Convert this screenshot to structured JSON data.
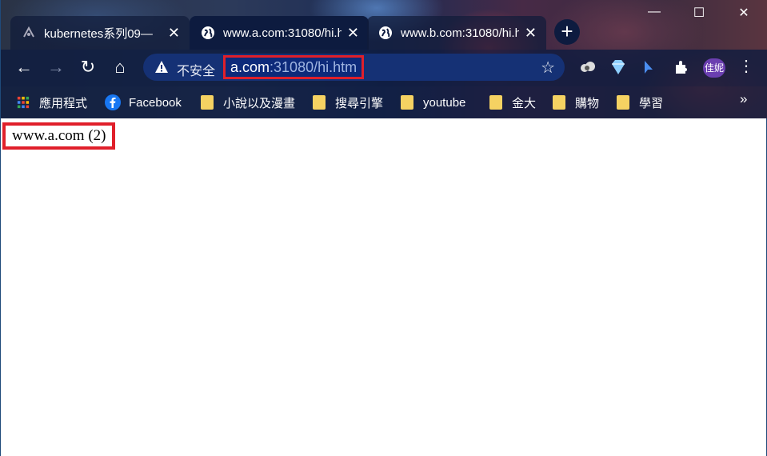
{
  "tabs": [
    {
      "title": "kubernetes系列09—",
      "close": "✕",
      "icon": "k8s-logo-icon"
    },
    {
      "title": "www.a.com:31080/hi.h",
      "close": "✕",
      "icon": "globe-icon"
    },
    {
      "title": "www.b.com:31080/hi.h",
      "close": "✕",
      "icon": "globe-icon"
    }
  ],
  "new_tab": "+",
  "window_controls": {
    "minimize": "—",
    "maximize": "☐",
    "close": "✕"
  },
  "toolbar": {
    "back": "←",
    "forward": "→",
    "reload": "↻",
    "home": "⌂",
    "security_label": "不安全",
    "url_host": "a.com",
    "url_path": ":31080/hi.htm",
    "bookmark_star": "☆",
    "profile_label": "佳妮",
    "menu": "⋮"
  },
  "bookmarks": [
    {
      "label": "應用程式",
      "icon": "apps-grid-icon"
    },
    {
      "label": "Facebook",
      "icon": "facebook-icon"
    },
    {
      "label": "小說以及漫畫",
      "icon": "folder-icon"
    },
    {
      "label": "搜尋引擎",
      "icon": "folder-icon"
    },
    {
      "label": "youtube",
      "icon": "folder-icon"
    },
    {
      "label": "金大",
      "icon": "folder-icon"
    },
    {
      "label": "購物",
      "icon": "folder-icon"
    },
    {
      "label": "學習",
      "icon": "folder-icon"
    }
  ],
  "bookmarks_more": "»",
  "page": {
    "content": "www.a.com (2)"
  },
  "colors": {
    "highlight": "#e0202a",
    "toolbar": "#0d1b3f"
  }
}
